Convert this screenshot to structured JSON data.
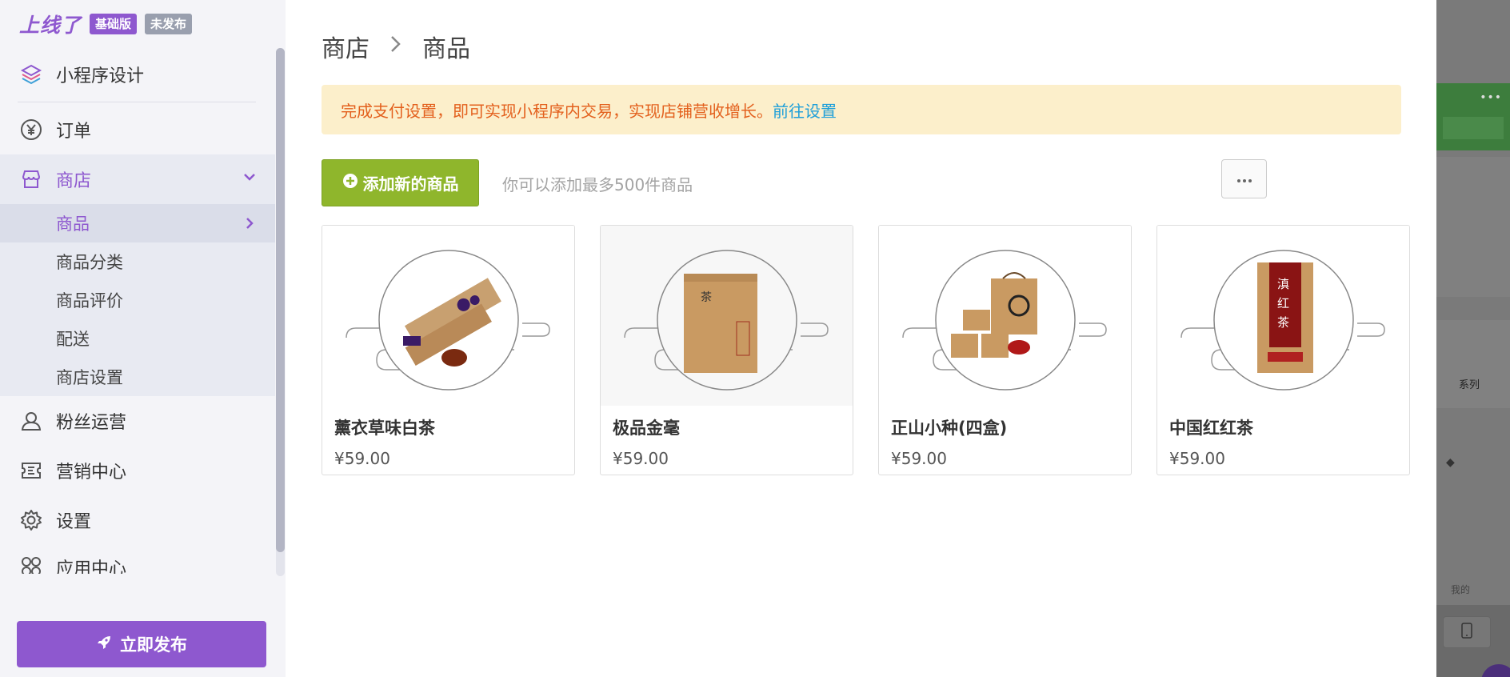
{
  "brand": {
    "logo": "上线了",
    "edition_badge": "基础版",
    "status_badge": "未发布"
  },
  "sidebar": {
    "design": "小程序设计",
    "orders": "订单",
    "store": "商店",
    "store_sub": [
      "商品",
      "商品分类",
      "商品评价",
      "配送",
      "商店设置"
    ],
    "fans": "粉丝运营",
    "marketing": "营销中心",
    "settings": "设置",
    "apps": "应用中心",
    "publish": "立即发布"
  },
  "breadcrumb": {
    "parent": "商店",
    "current": "商品"
  },
  "alert": {
    "text": "完成支付设置，即可实现小程序内交易，实现店铺营收增长。",
    "link": "前往设置"
  },
  "toolbar": {
    "add_label": "添加新的商品",
    "hint": "你可以添加最多500件商品",
    "more_label": "···"
  },
  "products": [
    {
      "name": "薰衣草味白茶",
      "price": "¥59.00"
    },
    {
      "name": "极品金毫",
      "price": "¥59.00"
    },
    {
      "name": "正山小种(四盒)",
      "price": "¥59.00"
    },
    {
      "name": "中国红红茶",
      "price": "¥59.00"
    }
  ],
  "preview": {
    "series_label": "系列",
    "me_label": "我的"
  },
  "colors": {
    "accent": "#8e58cf",
    "add_button": "#8fb62c",
    "alert_bg": "#fcefcb",
    "alert_text": "#e3601d",
    "link": "#1e9fd9"
  },
  "icons": {
    "design": "layers-icon",
    "orders": "yen-circle-icon",
    "store": "store-icon",
    "fans": "user-icon",
    "marketing": "ticket-icon",
    "settings": "gear-icon",
    "apps": "apps-icon",
    "publish": "rocket-icon"
  }
}
